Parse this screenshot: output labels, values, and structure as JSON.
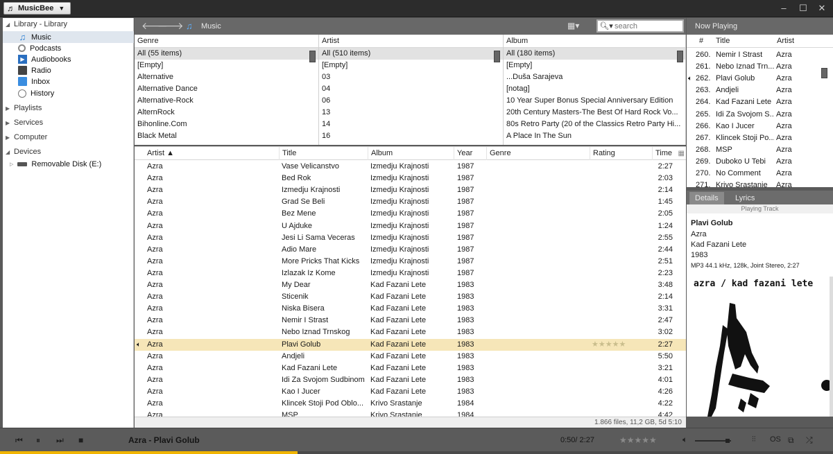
{
  "app": {
    "name": "MusicBee"
  },
  "sidebar": {
    "library_header": "Library - Library",
    "library_items": [
      {
        "label": "Music",
        "icon": "music-note-icon"
      },
      {
        "label": "Podcasts",
        "icon": "podcast-icon"
      },
      {
        "label": "Audiobooks",
        "icon": "audiobook-icon"
      },
      {
        "label": "Radio",
        "icon": "radio-icon"
      },
      {
        "label": "Inbox",
        "icon": "inbox-icon"
      },
      {
        "label": "History",
        "icon": "history-icon"
      }
    ],
    "playlists": "Playlists",
    "services": "Services",
    "computer": "Computer",
    "devices": "Devices",
    "removable_disk": "Removable Disk (E:)"
  },
  "header": {
    "breadcrumb": "Music",
    "search_placeholder": "search"
  },
  "filters": {
    "genre": {
      "header": "Genre",
      "items": [
        "All  (55 items)",
        "[Empty]",
        "Alternative",
        "Alternative Dance",
        "Alternative-Rock",
        "AlternRock",
        "Bihonline.Com",
        "Black Metal"
      ]
    },
    "artist": {
      "header": "Artist",
      "items": [
        "All  (510 items)",
        "[Empty]",
        "03",
        "04",
        "06",
        "13",
        "14",
        "16"
      ]
    },
    "album": {
      "header": "Album",
      "items": [
        "All  (180 items)",
        "[Empty]",
        "...Duša Sarajeva",
        "[notag]",
        "10 Year Super Bonus Special Anniversary Edition",
        "20th Century Masters-The Best Of Hard Rock Vo...",
        "80s Retro Party (20 of the Classics Retro Party Hi...",
        "A Place In The Sun"
      ]
    }
  },
  "tracks": {
    "columns": {
      "artist": "Artist ▲",
      "title": "Title",
      "album": "Album",
      "year": "Year",
      "genre": "Genre",
      "rating": "Rating",
      "time": "Time"
    },
    "rows": [
      {
        "artist": "Azra",
        "title": "Vase Velicanstvo",
        "album": "Izmedju Krajnosti",
        "year": "1987",
        "time": "2:27"
      },
      {
        "artist": "Azra",
        "title": "Bed Rok",
        "album": "Izmedju Krajnosti",
        "year": "1987",
        "time": "2:03"
      },
      {
        "artist": "Azra",
        "title": "Izmedju Krajnosti",
        "album": "Izmedju Krajnosti",
        "year": "1987",
        "time": "2:14"
      },
      {
        "artist": "Azra",
        "title": "Grad Se Beli",
        "album": "Izmedju Krajnosti",
        "year": "1987",
        "time": "1:45"
      },
      {
        "artist": "Azra",
        "title": "Bez Mene",
        "album": "Izmedju Krajnosti",
        "year": "1987",
        "time": "2:05"
      },
      {
        "artist": "Azra",
        "title": "U Ajduke",
        "album": "Izmedju Krajnosti",
        "year": "1987",
        "time": "1:24"
      },
      {
        "artist": "Azra",
        "title": "Jesi Li Sama Veceras",
        "album": "Izmedju Krajnosti",
        "year": "1987",
        "time": "2:55"
      },
      {
        "artist": "Azra",
        "title": "Adio Mare",
        "album": "Izmedju Krajnosti",
        "year": "1987",
        "time": "2:44"
      },
      {
        "artist": "Azra",
        "title": "More Pricks That Kicks",
        "album": "Izmedju Krajnosti",
        "year": "1987",
        "time": "2:51"
      },
      {
        "artist": "Azra",
        "title": "Izlazak Iz Kome",
        "album": "Izmedju Krajnosti",
        "year": "1987",
        "time": "2:23"
      },
      {
        "artist": "Azra",
        "title": "My Dear",
        "album": "Kad Fazani Lete",
        "year": "1983",
        "time": "3:48"
      },
      {
        "artist": "Azra",
        "title": "Sticenik",
        "album": "Kad Fazani Lete",
        "year": "1983",
        "time": "2:14"
      },
      {
        "artist": "Azra",
        "title": "Niska Bisera",
        "album": "Kad Fazani Lete",
        "year": "1983",
        "time": "3:31"
      },
      {
        "artist": "Azra",
        "title": "Nemir I Strast",
        "album": "Kad Fazani Lete",
        "year": "1983",
        "time": "2:47"
      },
      {
        "artist": "Azra",
        "title": "Nebo Iznad Trnskog",
        "album": "Kad Fazani Lete",
        "year": "1983",
        "time": "3:02"
      },
      {
        "artist": "Azra",
        "title": "Plavi Golub",
        "album": "Kad Fazani Lete",
        "year": "1983",
        "time": "2:27",
        "playing": true,
        "rating": "★★★★★"
      },
      {
        "artist": "Azra",
        "title": "Andjeli",
        "album": "Kad Fazani Lete",
        "year": "1983",
        "time": "5:50"
      },
      {
        "artist": "Azra",
        "title": "Kad Fazani Lete",
        "album": "Kad Fazani Lete",
        "year": "1983",
        "time": "3:21"
      },
      {
        "artist": "Azra",
        "title": "Idi Za Svojom Sudbinom",
        "album": "Kad Fazani Lete",
        "year": "1983",
        "time": "4:01"
      },
      {
        "artist": "Azra",
        "title": "Kao I Jucer",
        "album": "Kad Fazani Lete",
        "year": "1983",
        "time": "4:26"
      },
      {
        "artist": "Azra",
        "title": "Klincek Stoji Pod Oblo...",
        "album": "Krivo Srastanje",
        "year": "1984",
        "time": "4:22"
      },
      {
        "artist": "Azra",
        "title": "MSP",
        "album": "Krivo Srastanje",
        "year": "1984",
        "time": "4:42"
      }
    ]
  },
  "status": "1.866 files, 11,2 GB, 5d 5:10",
  "now_playing": {
    "header": "Now Playing",
    "columns": {
      "num": "#",
      "title": "Title",
      "artist": "Artist"
    },
    "rows": [
      {
        "num": "260.",
        "title": "Nemir I Strast",
        "artist": "Azra"
      },
      {
        "num": "261.",
        "title": "Nebo Iznad Trn...",
        "artist": "Azra"
      },
      {
        "num": "262.",
        "title": "Plavi Golub",
        "artist": "Azra",
        "playing": true
      },
      {
        "num": "263.",
        "title": "Andjeli",
        "artist": "Azra"
      },
      {
        "num": "264.",
        "title": "Kad Fazani Lete",
        "artist": "Azra"
      },
      {
        "num": "265.",
        "title": "Idi Za Svojom S...",
        "artist": "Azra"
      },
      {
        "num": "266.",
        "title": "Kao I Jucer",
        "artist": "Azra"
      },
      {
        "num": "267.",
        "title": "Klincek Stoji Po...",
        "artist": "Azra"
      },
      {
        "num": "268.",
        "title": "MSP",
        "artist": "Azra"
      },
      {
        "num": "269.",
        "title": "Duboko U Tebi",
        "artist": "Azra"
      },
      {
        "num": "270.",
        "title": "No Comment",
        "artist": "Azra"
      },
      {
        "num": "271.",
        "title": "Krivo Srastanje",
        "artist": "Azra"
      }
    ]
  },
  "details": {
    "tabs": [
      "Details",
      "Lyrics"
    ],
    "subtitle": "Playing Track",
    "title": "Plavi Golub",
    "artist": "Azra",
    "album": "Kad Fazani Lete",
    "year": "1983",
    "format": "MP3 44.1 kHz, 128k, Joint Stereo, 2:27",
    "artwork_text": "azra / kad fazani lete"
  },
  "player": {
    "now_title": "Azra - Plavi Golub",
    "position": "0:50/ 2:27",
    "progress_fraction": 0.34,
    "volume_fraction": 0.9,
    "rating": "★★★★★"
  },
  "colors": {
    "accent": "#f0b400",
    "playing_row": "#f6e6b8",
    "header_bar": "#686868"
  }
}
